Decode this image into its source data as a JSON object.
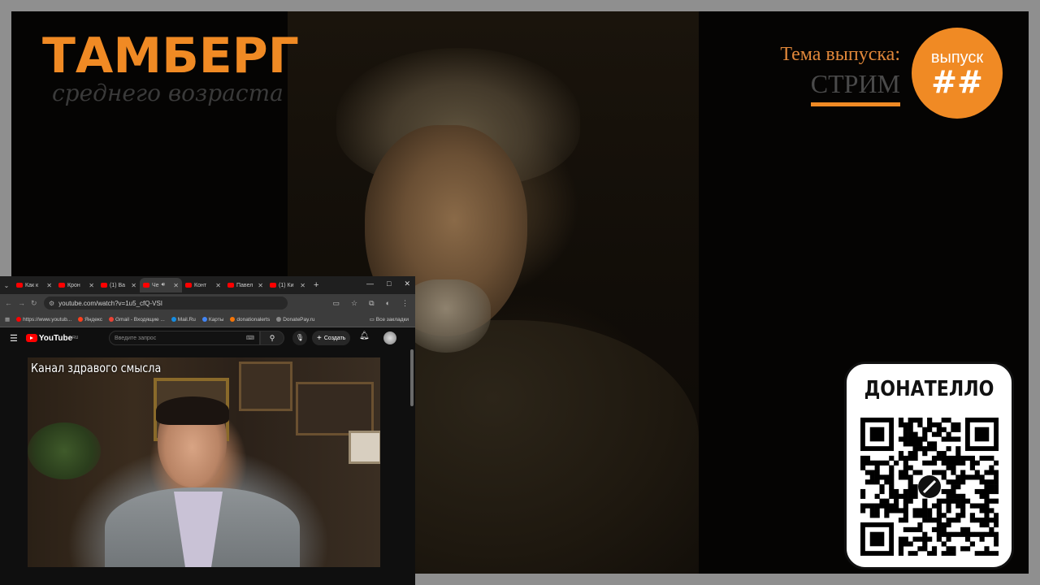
{
  "overlay": {
    "brand_title": "ТАМБЕРГ",
    "brand_subtitle": "среднего возраста",
    "topic_label": "Тема выпуска:",
    "topic_value": "СТРИМ",
    "badge_label": "выпуск",
    "badge_number": "##",
    "donate_title": "ДОНАТЕЛЛО",
    "accent_color": "#f08a24"
  },
  "browser": {
    "tabs": [
      {
        "label": "Как к",
        "icon": "youtube-icon"
      },
      {
        "label": "Крон",
        "icon": "youtube-icon"
      },
      {
        "label": "(1) Ва",
        "icon": "youtube-icon"
      },
      {
        "label": "Че",
        "icon": "youtube-icon",
        "active": true
      },
      {
        "label": "Конт",
        "icon": "youtube-icon"
      },
      {
        "label": "Павел",
        "icon": "youtube-icon"
      },
      {
        "label": "(1) Ки",
        "icon": "youtube-icon"
      }
    ],
    "new_tab": "+",
    "window_controls": {
      "minimize": "—",
      "maximize": "□",
      "close": "✕"
    },
    "url": "youtube.com/watch?v=1u5_cfQ-VSI",
    "bookmarks": [
      {
        "label": "https://www.youtub...",
        "color": "#ff0000"
      },
      {
        "label": "Яндекс",
        "color": "#fc3f1d"
      },
      {
        "label": "Gmail - Входящие ...",
        "color": "#ea4335"
      },
      {
        "label": "Mail.Ru",
        "color": "#168de2"
      },
      {
        "label": "Карты",
        "color": "#4285f4"
      },
      {
        "label": "donationalerts",
        "color": "#f57507"
      },
      {
        "label": "DonatePay.ru",
        "color": "#888888"
      }
    ],
    "all_bookmarks": "Все закладки"
  },
  "youtube": {
    "logo_text": "YouTube",
    "logo_region": "RU",
    "search_placeholder": "Введите запрос",
    "create_label": "Создать",
    "video_caption": "Канал здравого смысла"
  }
}
